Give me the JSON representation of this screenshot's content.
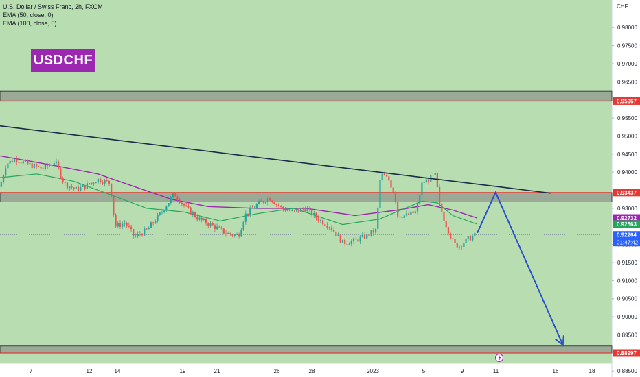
{
  "legend": {
    "symbol_line": "U.S. Dollar / Swiss Franc, 2h, FXCM",
    "ema50": "EMA (50, close, 0)",
    "ema100": "EMA (100, close, 0)"
  },
  "badge": {
    "text": "USDCHF",
    "color": "#9c27b0"
  },
  "currency": "CHF",
  "colors": {
    "background_green": "#b7ddb0",
    "up_candle": "#26a69a",
    "down_candle": "#ef5350",
    "ema50": "#26a65b",
    "ema100": "#9c27b0",
    "trendline": "#1b2a4a",
    "projection": "#2850c8",
    "zone_gray": "#8a8f8a",
    "level_red": "#e53935"
  },
  "chart_data": {
    "type": "candlestick",
    "x_tick_labels": [
      "7",
      "12",
      "14",
      "19",
      "21",
      "26",
      "28",
      "2023",
      "5",
      "9",
      "11",
      "16",
      "18"
    ],
    "y_ticks": [
      0.885,
      0.89,
      0.895,
      0.9,
      0.905,
      0.91,
      0.915,
      0.92,
      0.925,
      0.93,
      0.935,
      0.94,
      0.945,
      0.95,
      0.955,
      0.96,
      0.965,
      0.97,
      0.975,
      0.98
    ],
    "y_tick_labels": [
      "0.88500",
      "0.89000",
      "0.89500",
      "0.90000",
      "0.90500",
      "0.91000",
      "0.91500",
      "0.92000",
      "0.92500",
      "0.93000",
      "0.93500",
      "0.94000",
      "0.94500",
      "0.95000",
      "0.95500",
      "0.96000",
      "0.96500",
      "0.97000",
      "0.97500",
      "0.98000"
    ],
    "ylim": [
      0.88333,
      0.98763
    ],
    "price_markers": [
      {
        "label": "0.95967",
        "value": 0.95967,
        "color": "#e53935"
      },
      {
        "label": "0.93437",
        "value": 0.93437,
        "color": "#e53935"
      },
      {
        "label": "0.92732",
        "value": 0.92732,
        "color": "#9c27b0"
      },
      {
        "label": "0.92563",
        "value": 0.92563,
        "color": "#26a65b"
      },
      {
        "label": "0.92264",
        "value": 0.92264,
        "color": "#2962ff"
      },
      {
        "label": "0.88997",
        "value": 0.88997,
        "color": "#e53935"
      }
    ],
    "countdown": "01:47:42",
    "zones": [
      {
        "from": 0.95967,
        "to": 0.96238
      },
      {
        "from": 0.93178,
        "to": 0.93437
      },
      {
        "from": 0.88997,
        "to": 0.89191
      }
    ],
    "trendline": {
      "from": [
        0,
        0.9528
      ],
      "to": [
        0.9,
        0.9342
      ]
    },
    "projection": [
      [
        0.78,
        0.9232
      ],
      [
        0.81,
        0.9344
      ],
      [
        0.92,
        0.8922
      ]
    ],
    "price_path": [
      [
        0.0,
        0.9359
      ],
      [
        0.01,
        0.9423
      ],
      [
        0.025,
        0.9436
      ],
      [
        0.045,
        0.9422
      ],
      [
        0.07,
        0.941
      ],
      [
        0.09,
        0.943
      ],
      [
        0.105,
        0.9368
      ],
      [
        0.125,
        0.9352
      ],
      [
        0.14,
        0.9362
      ],
      [
        0.16,
        0.938
      ],
      [
        0.18,
        0.937
      ],
      [
        0.188,
        0.925
      ],
      [
        0.205,
        0.926
      ],
      [
        0.22,
        0.922
      ],
      [
        0.24,
        0.924
      ],
      [
        0.26,
        0.928
      ],
      [
        0.285,
        0.934
      ],
      [
        0.305,
        0.93
      ],
      [
        0.325,
        0.927
      ],
      [
        0.35,
        0.925
      ],
      [
        0.37,
        0.923
      ],
      [
        0.39,
        0.9225
      ],
      [
        0.4,
        0.928
      ],
      [
        0.42,
        0.931
      ],
      [
        0.44,
        0.933
      ],
      [
        0.46,
        0.93
      ],
      [
        0.48,
        0.929
      ],
      [
        0.5,
        0.93
      ],
      [
        0.52,
        0.927
      ],
      [
        0.54,
        0.925
      ],
      [
        0.56,
        0.9205
      ],
      [
        0.58,
        0.921
      ],
      [
        0.6,
        0.9225
      ],
      [
        0.615,
        0.924
      ],
      [
        0.622,
        0.9395
      ],
      [
        0.635,
        0.938
      ],
      [
        0.645,
        0.934
      ],
      [
        0.65,
        0.928
      ],
      [
        0.665,
        0.928
      ],
      [
        0.68,
        0.929
      ],
      [
        0.69,
        0.937
      ],
      [
        0.705,
        0.9385
      ],
      [
        0.712,
        0.9392
      ],
      [
        0.718,
        0.931
      ],
      [
        0.73,
        0.925
      ],
      [
        0.742,
        0.92
      ],
      [
        0.75,
        0.9195
      ],
      [
        0.765,
        0.9215
      ],
      [
        0.777,
        0.9226
      ]
    ],
    "ema50": [
      [
        0.0,
        0.9385
      ],
      [
        0.06,
        0.9395
      ],
      [
        0.12,
        0.9375
      ],
      [
        0.185,
        0.9335
      ],
      [
        0.24,
        0.93
      ],
      [
        0.3,
        0.929
      ],
      [
        0.36,
        0.9265
      ],
      [
        0.42,
        0.9285
      ],
      [
        0.48,
        0.93
      ],
      [
        0.56,
        0.9255
      ],
      [
        0.62,
        0.927
      ],
      [
        0.69,
        0.932
      ],
      [
        0.715,
        0.9315
      ],
      [
        0.74,
        0.928
      ],
      [
        0.78,
        0.9256
      ]
    ],
    "ema100": [
      [
        0.0,
        0.9445
      ],
      [
        0.05,
        0.943
      ],
      [
        0.1,
        0.9415
      ],
      [
        0.16,
        0.9395
      ],
      [
        0.22,
        0.936
      ],
      [
        0.28,
        0.9325
      ],
      [
        0.34,
        0.9305
      ],
      [
        0.42,
        0.93
      ],
      [
        0.5,
        0.93
      ],
      [
        0.58,
        0.928
      ],
      [
        0.65,
        0.9295
      ],
      [
        0.7,
        0.931
      ],
      [
        0.74,
        0.9295
      ],
      [
        0.78,
        0.9273
      ]
    ]
  }
}
